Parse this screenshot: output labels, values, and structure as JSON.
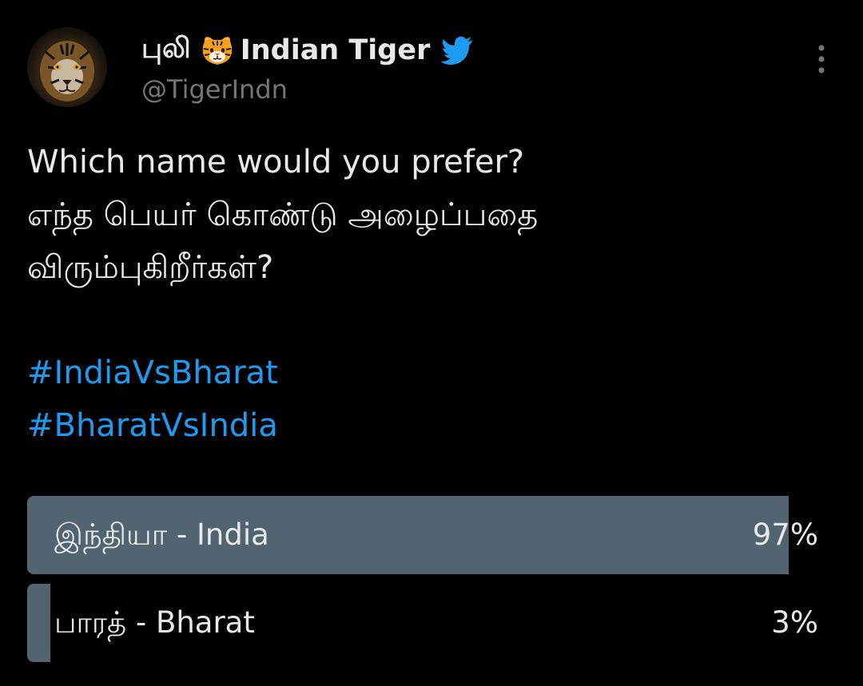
{
  "author": {
    "display_name_prefix": "புலி",
    "display_name": "Indian Tiger",
    "handle": "@TigerIndn",
    "avatar_icon": "tiger-face",
    "name_emoji": "tiger-face-emoji",
    "badge_icon": "twitter-bird-icon"
  },
  "tweet": {
    "lines": [
      "Which name would you prefer?",
      "எந்த பெயர் கொண்டு அழைப்பதை",
      "விரும்புகிறீர்கள்?"
    ],
    "hashtags": [
      "#IndiaVsBharat",
      "#BharatVsIndia"
    ]
  },
  "poll": {
    "options": [
      {
        "label": "இந்தியா - India",
        "percent_text": "97%",
        "percent": 97
      },
      {
        "label": "பாரத் - Bharat",
        "percent_text": "3%",
        "percent": 3
      }
    ]
  },
  "colors": {
    "background": "#000000",
    "text": "#e7e9ea",
    "muted": "#71767b",
    "hashtag": "#1d9bf0",
    "poll_bar": "#536471"
  }
}
